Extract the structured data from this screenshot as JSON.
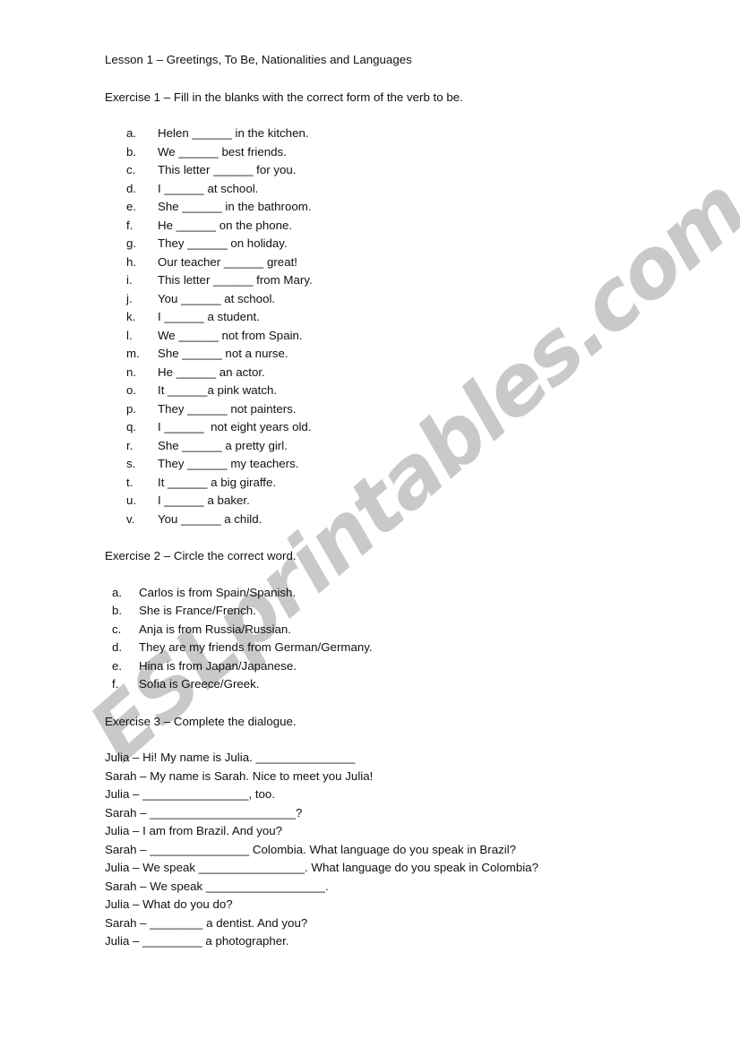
{
  "watermark": {
    "text": "ESLprintables.com",
    "color": "#c9c9c9"
  },
  "document": {
    "title": "Lesson 1 – Greetings, To Be, Nationalities and Languages",
    "exercise1": {
      "instruction": "Exercise 1 – Fill in the blanks with the correct form of the verb to be.",
      "items": [
        {
          "marker": "a.",
          "text": "Helen ______ in the kitchen."
        },
        {
          "marker": "b.",
          "text": "We ______ best friends."
        },
        {
          "marker": "c.",
          "text": "This letter ______ for you."
        },
        {
          "marker": "d.",
          "text": "I ______ at school."
        },
        {
          "marker": "e.",
          "text": "She ______ in the bathroom."
        },
        {
          "marker": "f.",
          "text": "He ______ on the phone."
        },
        {
          "marker": "g.",
          "text": "They ______ on holiday."
        },
        {
          "marker": "h.",
          "text": "Our teacher ______ great!"
        },
        {
          "marker": "i.",
          "text": "This letter ______ from Mary."
        },
        {
          "marker": "j.",
          "text": "You ______ at school."
        },
        {
          "marker": "k.",
          "text": "I ______ a student."
        },
        {
          "marker": "l.",
          "text": "We ______ not from Spain."
        },
        {
          "marker": "m.",
          "text": "She ______ not a nurse."
        },
        {
          "marker": "n.",
          "text": "He ______ an actor."
        },
        {
          "marker": "o.",
          "text": "It ______a pink watch."
        },
        {
          "marker": "p.",
          "text": "They ______ not painters."
        },
        {
          "marker": "q.",
          "text": "I ______  not eight years old."
        },
        {
          "marker": "r.",
          "text": "She ______ a pretty girl."
        },
        {
          "marker": "s.",
          "text": "They ______ my teachers."
        },
        {
          "marker": "t.",
          "text": "It ______ a big giraffe."
        },
        {
          "marker": "u.",
          "text": "I ______ a baker."
        },
        {
          "marker": "v.",
          "text": "You ______ a child."
        }
      ]
    },
    "exercise2": {
      "instruction": "Exercise 2 – Circle the correct word.",
      "items": [
        {
          "marker": "a.",
          "text": "Carlos is from Spain/Spanish."
        },
        {
          "marker": "b.",
          "text": "She is France/French."
        },
        {
          "marker": "c.",
          "text": "Anja is from Russia/Russian."
        },
        {
          "marker": "d.",
          "text": "They are my friends from German/Germany."
        },
        {
          "marker": "e.",
          "text": "Hina is from Japan/Japanese."
        },
        {
          "marker": "f.",
          "text": "Sofia is Greece/Greek."
        }
      ]
    },
    "exercise3": {
      "instruction": "Exercise 3 – Complete the dialogue.",
      "lines": [
        "Julia – Hi! My name is Julia. _______________",
        "Sarah – My name is Sarah. Nice to meet you Julia!",
        "Julia – ________________, too.",
        "Sarah – ______________________?",
        "Julia – I am from Brazil. And you?",
        "Sarah – _______________ Colombia. What language do you speak in Brazil?",
        "Julia – We speak ________________. What language do you speak in Colombia?",
        "Sarah – We speak __________________.",
        "Julia – What do you do?",
        "Sarah – ________ a dentist. And you?",
        "Julia – _________ a photographer."
      ]
    }
  }
}
